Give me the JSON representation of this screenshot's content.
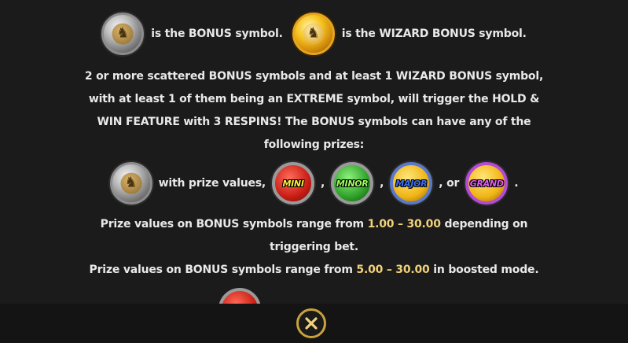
{
  "symbols": {
    "bonus_text": "is the BONUS symbol.",
    "wizard_text": "is the WIZARD BONUS symbol."
  },
  "description": {
    "line1": "2 or more scattered BONUS symbols and at least 1 WIZARD BONUS symbol,",
    "line2": "with at least 1 of them being an EXTREME symbol, will trigger the HOLD &",
    "line3": "WIN FEATURE with 3 RESPINS! The BONUS symbols can have any of the",
    "line4": "following prizes:"
  },
  "prizes": {
    "intro": "with prize values,",
    "sep1": ",",
    "sep2": ",",
    "sep3": ", or",
    "end": ".",
    "jackpots": [
      "MINI",
      "MINOR",
      "MAJOR",
      "GRAND"
    ]
  },
  "range_normal": {
    "pre": "Prize values on BONUS symbols range from",
    "value": "1.00 – 30.00",
    "post": "depending on",
    "line2": "triggering bet."
  },
  "range_boosted": {
    "pre": "Prize values on BONUS symbols range from",
    "value": "5.00 – 30.00",
    "post": "in boosted mode."
  },
  "colors": {
    "background": "#1b1b1b",
    "text": "#e9e9e9",
    "highlight": "#f0d27a",
    "close_ring": "#c9a23c"
  },
  "icons": {
    "bonus_coin": "silver-bonus-coin-icon",
    "wizard_coin": "gold-wizard-coin-icon",
    "close": "close-x-icon"
  }
}
